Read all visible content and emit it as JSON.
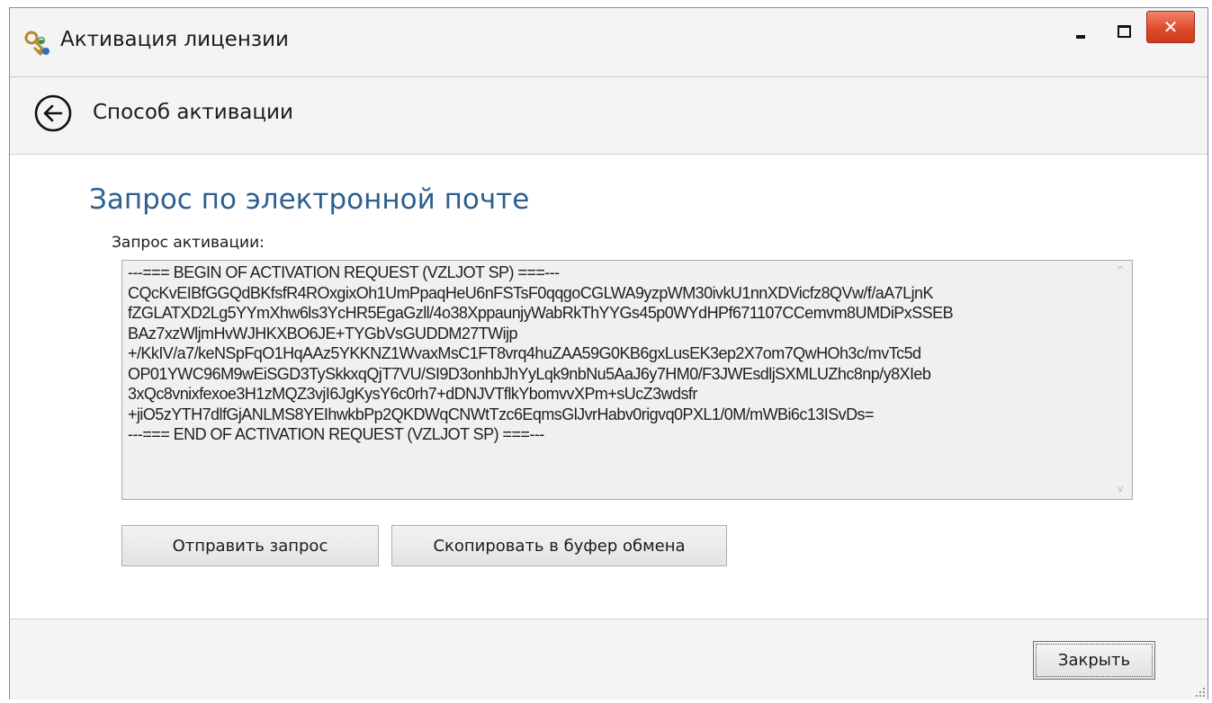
{
  "window": {
    "title": "Активация лицензии",
    "close_glyph": "✕",
    "icon_name": "key-license-icon"
  },
  "nav": {
    "title": "Способ активации",
    "back_icon": "back-arrow-circle-icon"
  },
  "content": {
    "heading": "Запрос по электронной почте",
    "field_label": "Запрос активации:",
    "request_text": "---=== BEGIN OF ACTIVATION REQUEST (VZLJOT SP) ===---\nCQcKvEIBfGGQdBKfsfR4ROxgixOh1UmPpaqHeU6nFSTsF0qqgoCGLWA9yzpWM30ivkU1nnXDVicfz8QVw/f/aA7LjnK\nfZGLATXD2Lg5YYmXhw6ls3YcHR5EgaGzll/4o38XppaunjyWabRkThYYGs45p0WYdHPf671107CCemvm8UMDiPxSSEB\nBAz7xzWljmHvWJHKXBO6JE+TYGbVsGUDDM27TWijp\n+/KkIV/a7/keNSpFqO1HqAAz5YKKNZ1WvaxMsC1FT8vrq4huZAA59G0KB6gxLusEK3ep2X7om7QwHOh3c/mvTc5d\nOP01YWC96M9wEiSGD3TySkkxqQjT7VU/SI9D3onhbJhYyLqk9nbNu5AaJ6y7HM0/F3JWEsdljSXMLUZhc8np/y8XIeb\n3xQc8vnixfexoe3H1zMQZ3vjI6JgKysY6c0rh7+dDNJVTflkYbomvvXPm+sUcZ3wdsfr\n+jiO5zYTH7dlfGjANLMS8YEIhwkbPp2QKDWqCNWtTzc6EqmsGlJvrHabv0rigvq0PXL1/0M/mWBi6c13ISvDs=\n---=== END OF ACTIVATION REQUEST (VZLJOT SP) ===---",
    "scroll_up_glyph": "^",
    "scroll_down_glyph": "v",
    "send_button": "Отправить запрос",
    "copy_button": "Скопировать в буфер обмена"
  },
  "footer": {
    "close_button": "Закрыть"
  },
  "colors": {
    "heading": "#2d5f8f",
    "window_border": "#6f93c4",
    "close_button": "#e04a2c",
    "panel_bg": "#f4f4f4",
    "textbox_bg": "#f0f0f0"
  }
}
